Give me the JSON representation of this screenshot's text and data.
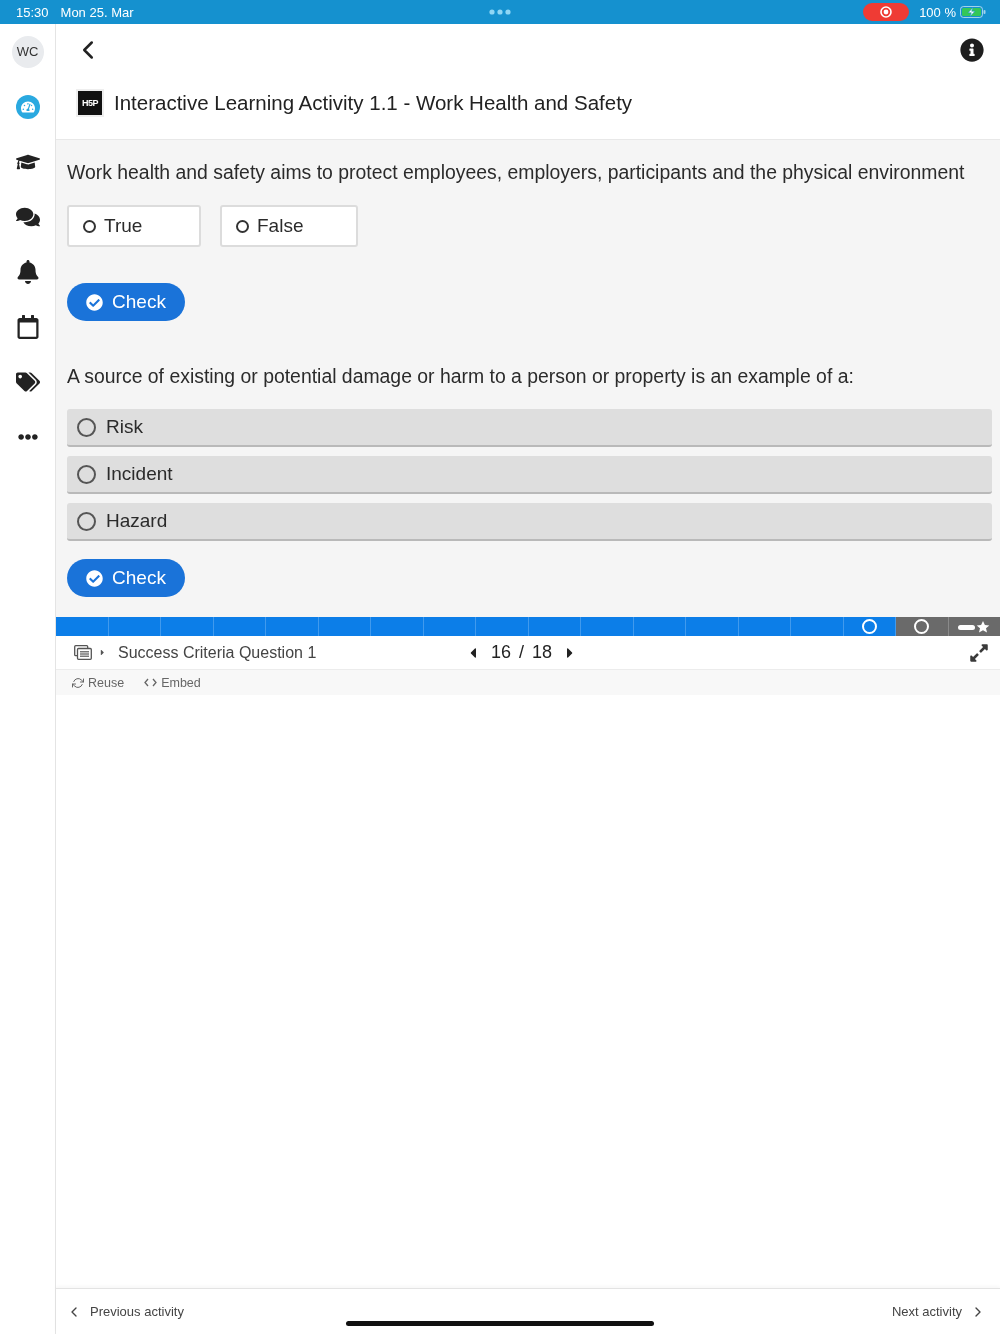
{
  "status_bar": {
    "time": "15:30",
    "date": "Mon 25. Mar",
    "battery": "100 %"
  },
  "sidebar": {
    "avatar": "WC",
    "items": [
      {
        "selected": true
      },
      {
        "selected": false
      },
      {
        "selected": false
      },
      {
        "selected": false
      },
      {
        "selected": false
      },
      {
        "selected": false
      },
      {
        "selected": false
      }
    ]
  },
  "header": {
    "logo": "H5P",
    "title": "Interactive Learning Activity 1.1 - Work Health and Safety"
  },
  "questions": [
    {
      "kind": "true_false",
      "text": "Work health and safety aims to protect employees, employers, participants and the physical environment",
      "options": [
        {
          "label": "True",
          "selected": false
        },
        {
          "label": "False",
          "selected": false
        }
      ],
      "button": "Check"
    },
    {
      "kind": "multiple_choice",
      "text": "A source of existing or potential damage or harm to a person or property is an example of a:",
      "options": [
        {
          "label": "Risk",
          "selected": false
        },
        {
          "label": "Incident",
          "selected": false
        },
        {
          "label": "Hazard",
          "selected": false
        }
      ],
      "button": "Check"
    }
  ],
  "slide_bar": {
    "slides": [
      {
        "visited": true,
        "kind": "plain"
      },
      {
        "visited": true,
        "kind": "plain"
      },
      {
        "visited": true,
        "kind": "plain"
      },
      {
        "visited": true,
        "kind": "plain"
      },
      {
        "visited": true,
        "kind": "plain"
      },
      {
        "visited": true,
        "kind": "plain"
      },
      {
        "visited": true,
        "kind": "plain"
      },
      {
        "visited": true,
        "kind": "plain"
      },
      {
        "visited": true,
        "kind": "plain"
      },
      {
        "visited": true,
        "kind": "plain"
      },
      {
        "visited": true,
        "kind": "plain"
      },
      {
        "visited": true,
        "kind": "plain"
      },
      {
        "visited": true,
        "kind": "plain"
      },
      {
        "visited": true,
        "kind": "plain"
      },
      {
        "visited": true,
        "kind": "plain"
      },
      {
        "visited": true,
        "kind": "task"
      },
      {
        "visited": false,
        "kind": "task"
      },
      {
        "visited": false,
        "kind": "summary"
      }
    ]
  },
  "footer": {
    "slide_title": "Success Criteria Question 1",
    "counter": "16 / 18"
  },
  "actions": [
    {
      "label": "Reuse"
    },
    {
      "label": "Embed"
    }
  ],
  "bottom_nav": {
    "previous": "Previous activity",
    "next": "Next activity"
  }
}
